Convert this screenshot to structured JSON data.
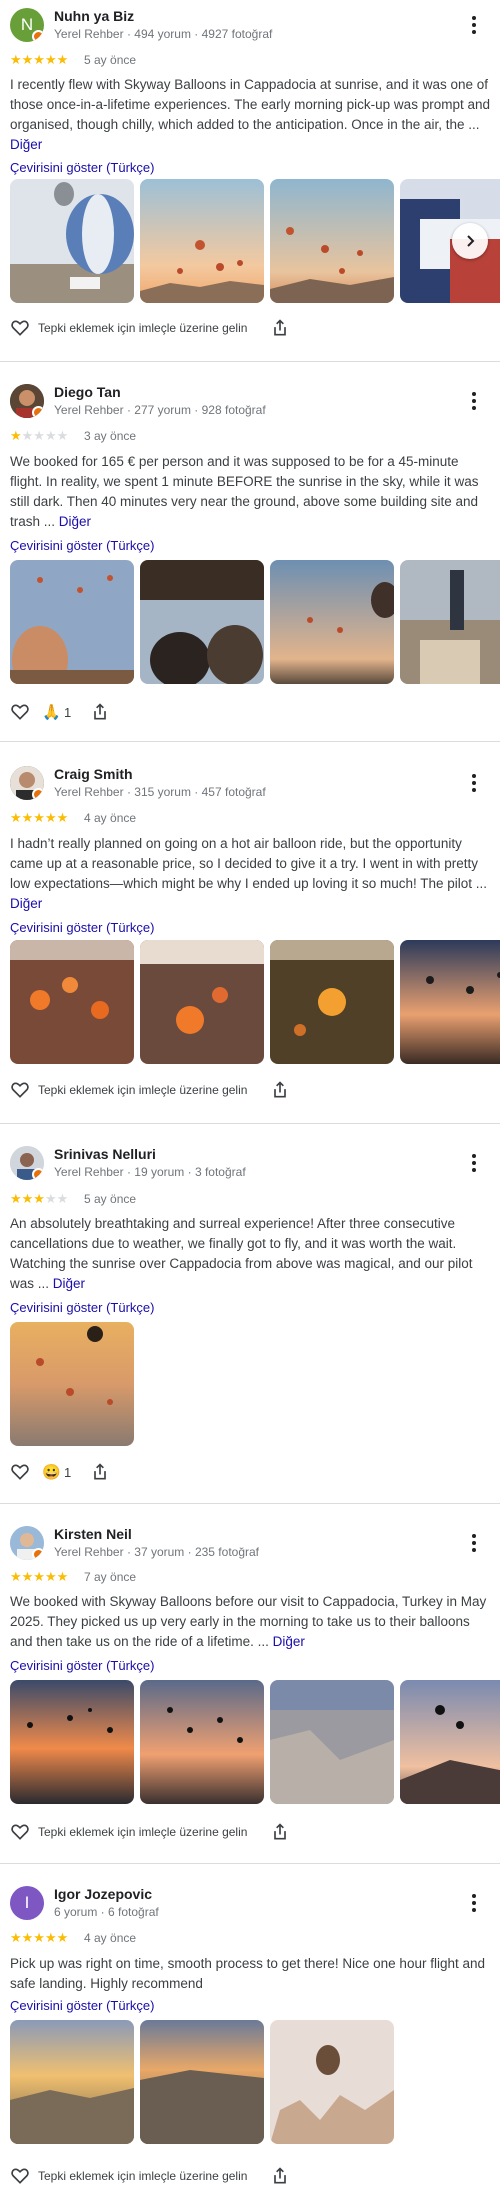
{
  "labels": {
    "more_link": "Diğer",
    "translate": "Çevirisini göster (Türkçe)",
    "react_hint": "Tepki eklemek için imleçle üzerine gelin"
  },
  "reviews": [
    {
      "name": "Nuhn ya Biz",
      "meta": "Yerel Rehber · 494 yorum · 4927 fotoğraf",
      "rating": 5,
      "date": "5 ay önce",
      "text": "I recently flew with Skyway Balloons in Cappadocia at sunrise, and it was one of those once-in-a-lifetime experiences. The early morning pick-up was prompt and organised, though chilly, which added to the anticipation. Once in the air, the ...",
      "avatar_letter": "N",
      "avatar_color": "#689f38",
      "photo_count": 4
    },
    {
      "name": "Diego Tan",
      "meta": "Yerel Rehber · 277 yorum · 928 fotoğraf",
      "rating": 1,
      "date": "3 ay önce",
      "text": "We booked for 165 € per person and it was supposed to be for a 45-minute flight. In reality, we spent 1 minute BEFORE the sunrise in the sky, while it was still dark. Then 40 minutes very near the ground, above some building site and trash ...",
      "reaction": "🙏",
      "reaction_count": "1",
      "photo_count": 4
    },
    {
      "name": "Craig Smith",
      "meta": "Yerel Rehber · 315 yorum · 457 fotoğraf",
      "rating": 5,
      "date": "4 ay önce",
      "text": "I hadn’t really planned on going on a hot air balloon ride, but the opportunity came up at a reasonable price, so I decided to give it a try. I went in with pretty low expectations—which might be why I ended up loving it so much! The pilot ...",
      "photo_count": 4
    },
    {
      "name": "Srinivas Nelluri",
      "meta": "Yerel Rehber · 19 yorum · 3 fotoğraf",
      "rating": 3,
      "date": "5 ay önce",
      "text": "An absolutely breathtaking and surreal experience! After three consecutive cancellations due to weather, we finally got to fly, and it was worth the wait. Watching the sunrise over Cappadocia from above was magical, and our pilot was ...",
      "reaction": "😀",
      "reaction_count": "1",
      "photo_count": 1
    },
    {
      "name": "Kirsten Neil",
      "meta": "Yerel Rehber · 37 yorum · 235 fotoğraf",
      "rating": 5,
      "date": "7 ay önce",
      "text": "We booked with Skyway Balloons before our visit to Cappadocia, Turkey in May 2025. They picked us up very early in the morning to take us to their balloons and then take us on the ride of a lifetime. ...",
      "photo_count": 4
    },
    {
      "name": "Igor Jozepovic",
      "meta": "6 yorum · 6 fotoğraf",
      "rating": 5,
      "date": "4 ay önce",
      "text": "Pick up was right on time, smooth process to get there! Nice one hour flight and safe landing. Highly recommend",
      "avatar_letter": "I",
      "avatar_color": "#7e57c2",
      "photo_count": 3
    }
  ]
}
